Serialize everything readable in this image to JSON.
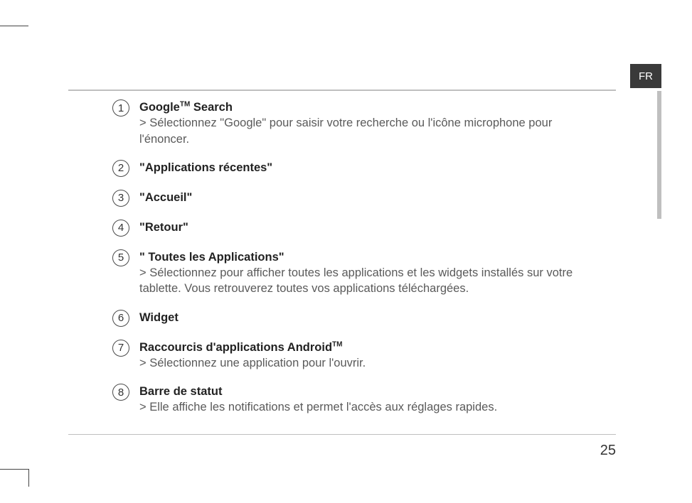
{
  "language_tab": "FR",
  "page_number": "25",
  "items": [
    {
      "number": "1",
      "title_pre": "Google",
      "title_tm": "TM",
      "title_post": " Search",
      "desc": "> Sélectionnez \"Google\" pour saisir votre recherche ou l'icône microphone pour l'énoncer."
    },
    {
      "number": "2",
      "title_pre": "\"Applications récentes\"",
      "title_tm": "",
      "title_post": "",
      "desc": ""
    },
    {
      "number": "3",
      "title_pre": "\"Accueil\"",
      "title_tm": "",
      "title_post": "",
      "desc": ""
    },
    {
      "number": "4",
      "title_pre": "\"Retour\"",
      "title_tm": "",
      "title_post": "",
      "desc": ""
    },
    {
      "number": "5",
      "title_pre": "\" Toutes les Applications\"",
      "title_tm": "",
      "title_post": "",
      "desc": "> Sélectionnez pour afficher toutes les applications et les widgets installés sur votre tablette. Vous retrouverez toutes vos applications téléchargées."
    },
    {
      "number": "6",
      "title_pre": "Widget",
      "title_tm": "",
      "title_post": "",
      "desc": ""
    },
    {
      "number": "7",
      "title_pre": "Raccourcis d'applications Android",
      "title_tm": "TM",
      "title_post": "",
      "desc": "> Sélectionnez une application pour l'ouvrir."
    },
    {
      "number": "8",
      "title_pre": "Barre de statut",
      "title_tm": "",
      "title_post": "",
      "desc": "> Elle affiche les notifications et permet l'accès aux réglages rapides."
    }
  ]
}
